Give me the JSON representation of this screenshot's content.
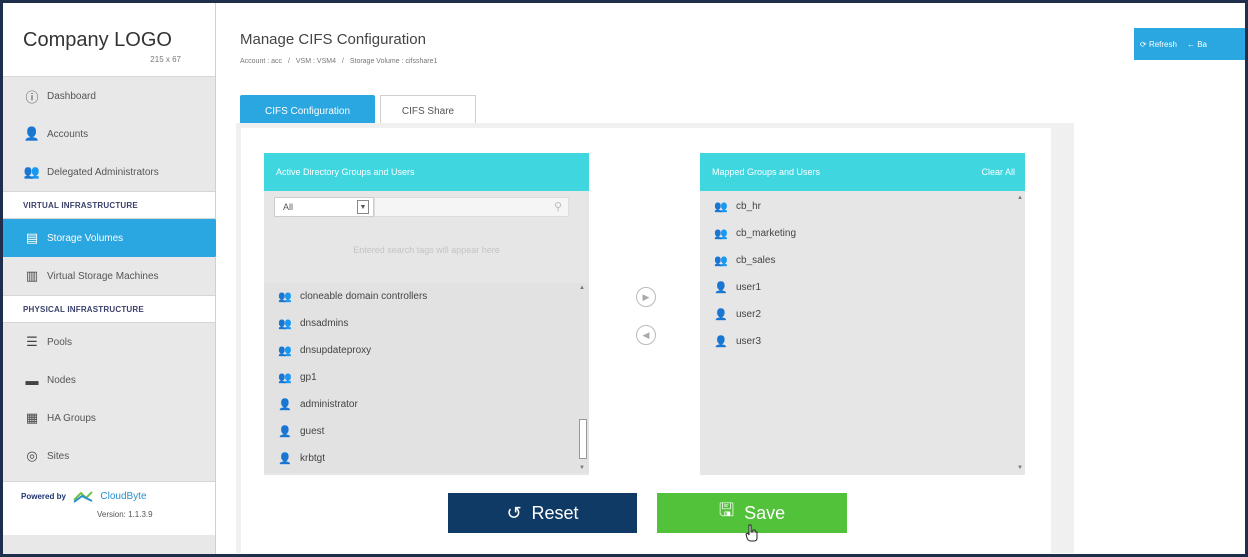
{
  "sidebar": {
    "logo_text": "Company LOGO",
    "logo_size": "215 x 67",
    "items_top": [
      {
        "label": "Dashboard",
        "icon": "info-circle-icon"
      },
      {
        "label": "Accounts",
        "icon": "user-icon"
      },
      {
        "label": "Delegated Administrators",
        "icon": "users-icon"
      }
    ],
    "section_virtual": "VIRTUAL INFRASTRUCTURE",
    "items_virtual": [
      {
        "label": "Storage Volumes",
        "icon": "database-icon",
        "active": true
      },
      {
        "label": "Virtual Storage Machines",
        "icon": "server-icon"
      }
    ],
    "section_physical": "PHYSICAL INFRASTRUCTURE",
    "items_physical": [
      {
        "label": "Pools",
        "icon": "layers-icon"
      },
      {
        "label": "Nodes",
        "icon": "node-icon"
      },
      {
        "label": "HA Groups",
        "icon": "grid-icon"
      },
      {
        "label": "Sites",
        "icon": "site-icon"
      }
    ],
    "powered_by": "Powered by",
    "brand": "CloudByte",
    "version": "Version: 1.1.3.9"
  },
  "header": {
    "title": "Manage CIFS Configuration",
    "breadcrumb": [
      "Account : acc",
      "VSM : VSM4",
      "Storage Volume : cifsshare1"
    ],
    "refresh_label": "Refresh",
    "back_label": "Ba"
  },
  "tabs": [
    {
      "label": "CIFS Configuration",
      "active": true
    },
    {
      "label": "CIFS Share",
      "active": false
    }
  ],
  "left_panel": {
    "title": "Active Directory Groups and Users",
    "filter_value": "All",
    "search_placeholder": "",
    "tags_hint": "Entered search tags will appear here",
    "items": [
      {
        "label": "cloneable domain controllers",
        "type": "group"
      },
      {
        "label": "dnsadmins",
        "type": "group"
      },
      {
        "label": "dnsupdateproxy",
        "type": "group"
      },
      {
        "label": "gp1",
        "type": "group"
      },
      {
        "label": "administrator",
        "type": "user"
      },
      {
        "label": "guest",
        "type": "user"
      },
      {
        "label": "krbtgt",
        "type": "user"
      }
    ]
  },
  "right_panel": {
    "title": "Mapped Groups and Users",
    "clear_all": "Clear All",
    "items": [
      {
        "label": "cb_hr",
        "type": "group"
      },
      {
        "label": "cb_marketing",
        "type": "group"
      },
      {
        "label": "cb_sales",
        "type": "group"
      },
      {
        "label": "user1",
        "type": "user"
      },
      {
        "label": "user2",
        "type": "user"
      },
      {
        "label": "user3",
        "type": "user"
      }
    ]
  },
  "actions": {
    "reset_label": "Reset",
    "save_label": "Save"
  },
  "colors": {
    "accent": "#2aa6e0",
    "panel_header": "#3fd6e0",
    "reset_bg": "#0f3a66",
    "save_bg": "#52c23a"
  }
}
